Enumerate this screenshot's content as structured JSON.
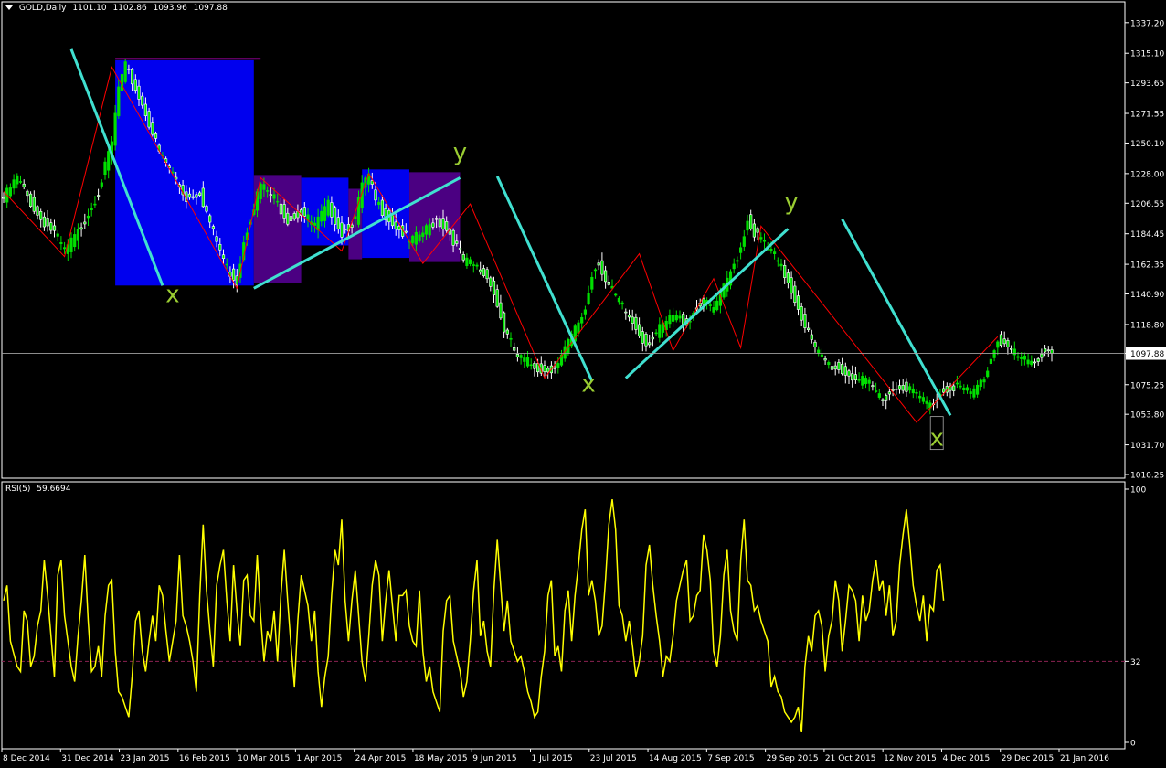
{
  "header": {
    "symbol": "GOLD,Daily",
    "open": "1101.10",
    "high": "1102.86",
    "low": "1093.96",
    "close": "1097.88"
  },
  "rsi_header": {
    "label": "RSI(5)",
    "value": "59.6694"
  },
  "colors": {
    "background": "#000000",
    "candle_bull": "#00e000",
    "candle_bear": "#ffffff",
    "zigzag": "#ff0000",
    "trendline": "#40e0d0",
    "wave_label": "#9acd32",
    "rsi_line": "#ffff00",
    "level_line": "#8b2252",
    "box_blue": "#0000ee",
    "box_purple": "#4b0082",
    "box_top_line": "#ff00ff",
    "current_price_badge": "#ffffff"
  },
  "chart_data": [
    {
      "type": "candlestick",
      "title": "GOLD,Daily",
      "ylim": [
        1010.25,
        1347
      ],
      "y_ticks": [
        "1337.20",
        "1315.10",
        "1293.65",
        "1271.55",
        "1250.10",
        "1228.00",
        "1206.55",
        "1184.45",
        "1162.35",
        "1140.90",
        "1118.80",
        "1097.88",
        "1075.25",
        "1053.80",
        "1031.70",
        "1010.25"
      ],
      "current_price": 1097.88,
      "x_ticks": [
        "8 Dec 2014",
        "31 Dec 2014",
        "23 Jan 2015",
        "16 Feb 2015",
        "10 Mar 2015",
        "1 Apr 2015",
        "24 Apr 2015",
        "18 May 2015",
        "9 Jun 2015",
        "1 Jul 2015",
        "23 Jul 2015",
        "14 Aug 2015",
        "7 Sep 2015",
        "29 Sep 2015",
        "21 Oct 2015",
        "12 Nov 2015",
        "4 Dec 2015",
        "29 Dec 2015",
        "21 Jan 2016"
      ],
      "close_path": [
        [
          0,
          1210
        ],
        [
          4,
          1225
        ],
        [
          10,
          1198
        ],
        [
          15,
          1185
        ],
        [
          18,
          1172
        ],
        [
          22,
          1185
        ],
        [
          28,
          1215
        ],
        [
          32,
          1250
        ],
        [
          34,
          1290
        ],
        [
          36,
          1305
        ],
        [
          38,
          1295
        ],
        [
          42,
          1272
        ],
        [
          46,
          1243
        ],
        [
          50,
          1228
        ],
        [
          54,
          1210
        ],
        [
          58,
          1215
        ],
        [
          62,
          1185
        ],
        [
          66,
          1160
        ],
        [
          69,
          1150
        ],
        [
          71,
          1180
        ],
        [
          74,
          1205
        ],
        [
          76,
          1220
        ],
        [
          80,
          1210
        ],
        [
          84,
          1195
        ],
        [
          88,
          1200
        ],
        [
          92,
          1190
        ],
        [
          96,
          1205
        ],
        [
          100,
          1185
        ],
        [
          104,
          1195
        ],
        [
          106,
          1220
        ],
        [
          108,
          1225
        ],
        [
          110,
          1208
        ],
        [
          114,
          1195
        ],
        [
          118,
          1185
        ],
        [
          120,
          1178
        ],
        [
          124,
          1185
        ],
        [
          128,
          1195
        ],
        [
          132,
          1185
        ],
        [
          136,
          1165
        ],
        [
          140,
          1160
        ],
        [
          144,
          1150
        ],
        [
          148,
          1115
        ],
        [
          152,
          1095
        ],
        [
          156,
          1090
        ],
        [
          160,
          1085
        ],
        [
          164,
          1090
        ],
        [
          168,
          1110
        ],
        [
          172,
          1130
        ],
        [
          174,
          1155
        ],
        [
          176,
          1165
        ],
        [
          178,
          1150
        ],
        [
          182,
          1135
        ],
        [
          186,
          1120
        ],
        [
          190,
          1105
        ],
        [
          194,
          1115
        ],
        [
          198,
          1125
        ],
        [
          202,
          1120
        ],
        [
          206,
          1135
        ],
        [
          210,
          1130
        ],
        [
          214,
          1150
        ],
        [
          218,
          1175
        ],
        [
          220,
          1195
        ],
        [
          222,
          1185
        ],
        [
          226,
          1175
        ],
        [
          228,
          1168
        ],
        [
          232,
          1150
        ],
        [
          236,
          1125
        ],
        [
          240,
          1100
        ],
        [
          244,
          1090
        ],
        [
          248,
          1085
        ],
        [
          252,
          1080
        ],
        [
          256,
          1075
        ],
        [
          260,
          1065
        ],
        [
          262,
          1070
        ],
        [
          266,
          1075
        ],
        [
          270,
          1068
        ],
        [
          274,
          1060
        ],
        [
          278,
          1072
        ],
        [
          282,
          1075
        ],
        [
          286,
          1068
        ],
        [
          290,
          1080
        ],
        [
          294,
          1108
        ],
        [
          296,
          1105
        ],
        [
          300,
          1095
        ],
        [
          304,
          1090
        ],
        [
          308,
          1100
        ]
      ],
      "zigzag": [
        [
          0,
          1215
        ],
        [
          18,
          1168
        ],
        [
          32,
          1305
        ],
        [
          69,
          1145
        ],
        [
          76,
          1225
        ],
        [
          100,
          1172
        ],
        [
          108,
          1228
        ],
        [
          124,
          1163
        ],
        [
          138,
          1206
        ],
        [
          160,
          1080
        ],
        [
          188,
          1170
        ],
        [
          198,
          1100
        ],
        [
          210,
          1152
        ],
        [
          218,
          1102
        ],
        [
          224,
          1190
        ],
        [
          270,
          1048
        ],
        [
          294,
          1110
        ]
      ],
      "trendlines": [
        [
          [
            20,
            1318
          ],
          [
            47,
            1147
          ]
        ],
        [
          [
            74,
            1145
          ],
          [
            135,
            1225
          ]
        ],
        [
          [
            146,
            1226
          ],
          [
            174,
            1078
          ]
        ],
        [
          [
            184,
            1080
          ],
          [
            232,
            1188
          ]
        ],
        [
          [
            248,
            1195
          ],
          [
            280,
            1053
          ]
        ]
      ],
      "boxes": [
        {
          "x0": 33,
          "x1": 74,
          "y0": 1147,
          "y1": 1310,
          "fill": "blue"
        },
        {
          "x0": 74,
          "x1": 88,
          "y0": 1149,
          "y1": 1227,
          "fill": "purple"
        },
        {
          "x0": 88,
          "x1": 102,
          "y0": 1176,
          "y1": 1225,
          "fill": "blue"
        },
        {
          "x0": 102,
          "x1": 106,
          "y0": 1166,
          "y1": 1217,
          "fill": "purple"
        },
        {
          "x0": 106,
          "x1": 120,
          "y0": 1167,
          "y1": 1231,
          "fill": "blue"
        },
        {
          "x0": 120,
          "x1": 135,
          "y0": 1164,
          "y1": 1229,
          "fill": "purple"
        }
      ],
      "box_top_line": {
        "x0": 33,
        "x1": 76,
        "y": 1311
      },
      "wave_labels": [
        {
          "text": "x",
          "x": 50,
          "y": 1135
        },
        {
          "text": "y",
          "x": 135,
          "y": 1238
        },
        {
          "text": "x",
          "x": 173,
          "y": 1070
        },
        {
          "text": "y",
          "x": 233,
          "y": 1202
        },
        {
          "text": "x",
          "x": 276,
          "y": 1031
        }
      ]
    },
    {
      "type": "line",
      "title": "RSI(5)",
      "ylim": [
        0,
        100
      ],
      "y_ticks": [
        "100",
        "32",
        "0"
      ],
      "level": 32,
      "series": [
        {
          "name": "RSI(5)",
          "values": [
            56,
            62,
            40,
            35,
            30,
            28,
            52,
            48,
            30,
            34,
            46,
            52,
            72,
            58,
            42,
            26,
            66,
            72,
            50,
            40,
            30,
            24,
            42,
            56,
            74,
            48,
            28,
            30,
            38,
            26,
            50,
            62,
            64,
            36,
            20,
            18,
            14,
            10,
            26,
            48,
            52,
            36,
            28,
            40,
            50,
            40,
            62,
            58,
            44,
            32,
            40,
            48,
            74,
            50,
            46,
            40,
            32,
            20,
            58,
            86,
            60,
            44,
            30,
            62,
            70,
            76,
            56,
            40,
            70,
            52,
            38,
            64,
            66,
            50,
            48,
            74,
            50,
            32,
            44,
            40,
            52,
            32,
            58,
            76,
            56,
            38,
            22,
            48,
            66,
            60,
            54,
            40,
            52,
            28,
            14,
            26,
            34,
            58,
            76,
            70,
            88,
            56,
            40,
            56,
            68,
            50,
            32,
            24,
            42,
            62,
            72,
            66,
            40,
            56,
            68,
            54,
            40,
            58,
            58,
            60,
            46,
            40,
            38,
            60,
            36,
            24,
            30,
            20,
            16,
            12,
            44,
            56,
            58,
            40,
            34,
            28,
            18,
            24,
            40,
            60,
            72,
            42,
            48,
            36,
            30,
            60,
            80,
            62,
            44,
            56,
            40,
            36,
            32,
            34,
            28,
            20,
            16,
            10,
            12,
            26,
            36,
            58,
            64,
            34,
            38,
            28,
            52,
            60,
            40,
            58,
            70,
            84,
            92,
            58,
            64,
            56,
            42,
            46,
            64,
            86,
            96,
            84,
            54,
            50,
            40,
            48,
            38,
            26,
            32,
            42,
            70,
            78,
            62,
            50,
            40,
            26,
            34,
            32,
            42,
            56,
            62,
            68,
            72,
            48,
            50,
            58,
            60,
            82,
            76,
            64,
            36,
            30,
            42,
            66,
            76,
            52,
            44,
            40,
            72,
            88,
            64,
            62,
            52,
            54,
            48,
            44,
            40,
            22,
            26,
            20,
            18,
            12,
            10,
            8,
            10,
            14,
            4,
            30,
            42,
            36,
            50,
            52,
            46,
            28,
            42,
            48,
            64,
            56,
            36,
            48,
            62,
            60,
            56,
            40,
            58,
            48,
            52,
            64,
            72,
            60,
            64,
            50,
            62,
            42,
            48,
            70,
            82,
            92,
            78,
            62,
            54,
            48,
            58,
            40,
            54,
            52,
            68,
            70,
            56
          ]
        }
      ]
    }
  ]
}
